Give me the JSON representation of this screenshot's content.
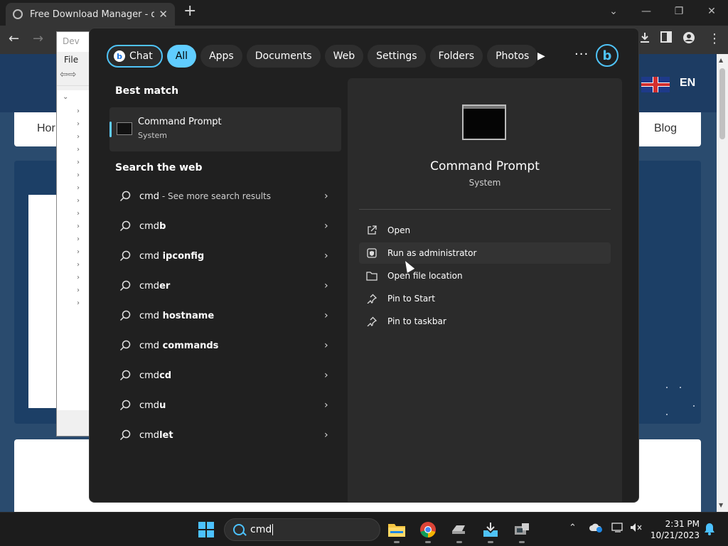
{
  "browser": {
    "tab_title": "Free Download Manager - downl",
    "tab_close": "✕",
    "new_tab": "+",
    "window_controls": [
      "⌄",
      "—",
      "❐",
      "✕"
    ]
  },
  "device_manager": {
    "title_fragment": "Dev",
    "menu_file": "File"
  },
  "website": {
    "nav_home": "Hor",
    "nav_blog": "Blog",
    "language": "EN"
  },
  "search_panel": {
    "filters": [
      "Chat",
      "All",
      "Apps",
      "Documents",
      "Web",
      "Settings",
      "Folders",
      "Photos"
    ],
    "active_filter": "All",
    "best_match_title": "Best match",
    "best_match": {
      "name": "Command Prompt",
      "type": "System"
    },
    "search_web_title": "Search the web",
    "web_results": [
      {
        "prefix": "cmd",
        "bold": "",
        "see_more": " - See more search results"
      },
      {
        "prefix": "cmd",
        "bold": "b",
        "see_more": ""
      },
      {
        "prefix": "cmd",
        "bold": " ipconfig",
        "see_more": ""
      },
      {
        "prefix": "cmd",
        "bold": "er",
        "see_more": ""
      },
      {
        "prefix": "cmd",
        "bold": " hostname",
        "see_more": ""
      },
      {
        "prefix": "cmd",
        "bold": " commands",
        "see_more": ""
      },
      {
        "prefix": "cmd",
        "bold": "cd",
        "see_more": ""
      },
      {
        "prefix": "cmd",
        "bold": "u",
        "see_more": ""
      },
      {
        "prefix": "cmd",
        "bold": "let",
        "see_more": ""
      }
    ],
    "details": {
      "app_name": "Command Prompt",
      "app_type": "System",
      "actions": [
        {
          "label": "Open",
          "icon": "open-external-icon"
        },
        {
          "label": "Run as administrator",
          "icon": "shield-admin-icon"
        },
        {
          "label": "Open file location",
          "icon": "folder-icon"
        },
        {
          "label": "Pin to Start",
          "icon": "pin-icon"
        },
        {
          "label": "Pin to taskbar",
          "icon": "pin-icon"
        }
      ]
    }
  },
  "taskbar": {
    "search_query": "cmd",
    "time": "2:31 PM",
    "date": "10/21/2023"
  },
  "colors": {
    "accent": "#60cdff",
    "panel_bg": "#202020",
    "details_bg": "#2b2b2b",
    "page_bg": "#2a4b6e"
  }
}
